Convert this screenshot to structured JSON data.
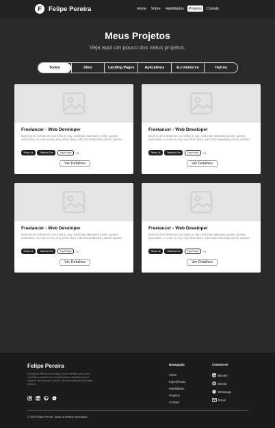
{
  "navbar": {
    "logo_letter": "F",
    "brand": "Felipe Pereira",
    "links": [
      "Home",
      "Sobre",
      "Habilidades",
      "Projetos",
      "Contato"
    ],
    "active_link": "Projetos"
  },
  "hero": {
    "title": "Meus Projetos",
    "subtitle": "Veja aqui um pouco dos meus projetos."
  },
  "filters": {
    "items": [
      "Todos",
      "Sites",
      "Landing Pages",
      "Aplicativos",
      "E-commerce",
      "Outros"
    ],
    "active": "Todos"
  },
  "projects": [
    {
      "title": "Freelancer - Web Developer",
      "description": "Body text for whatever you'd like to say. Add main takeaway points, quotes, anecdotes, or even a very very short story. Add main takeaway points, quotes.",
      "tags": [
        "React.Js",
        "Tailwind.Css",
        "TypeScript"
      ],
      "more": "+3",
      "button": "Ver Detalhes"
    },
    {
      "title": "Freelancer - Web Developer",
      "description": "Body text for whatever you'd like to say. Add main takeaway points, quotes, anecdotes, or even a very very short story. Add main takeaway points, quotes.",
      "tags": [
        "React.Js",
        "Tailwind.Css",
        "TypeScript"
      ],
      "more": "+3",
      "button": "Ver Detalhes"
    },
    {
      "title": "Freelancer - Web Developer",
      "description": "Body text for whatever you'd like to say. Add main takeaway points, quotes, anecdotes, or even a very very short story. Add main takeaway points, quotes.",
      "tags": [
        "React.Js",
        "Tailwind.Css",
        "TypeScript"
      ],
      "more": "+3",
      "button": "Ver Detalhes"
    },
    {
      "title": "Freelancer - Web Developer",
      "description": "Body text for whatever you'd like to say. Add main takeaway points, quotes, anecdotes, or even a very very short story. Add main takeaway points, quotes.",
      "tags": [
        "React.Js",
        "Tailwind.Css",
        "TypeScript"
      ],
      "more": "+3",
      "button": "Ver Detalhes"
    }
  ],
  "footer": {
    "name": "Felipe Pereira",
    "description": "Excepteur efficient emerging, minim veniam anim aute carefully curated Ginza conversation exquisite perfect nostrud nisi intricate Content. Qui international first-class nulla ut.",
    "social_icons": [
      "instagram-icon",
      "linkedin-icon",
      "github-icon",
      "whatsapp-icon"
    ],
    "nav_title": "Navegação",
    "nav_links": [
      "Sobre",
      "Experiências",
      "Habilidades",
      "Projetos",
      "Contato"
    ],
    "connect_title": "Conecte-se",
    "connect_links": [
      {
        "icon": "linkedin-icon",
        "label": "linkedin"
      },
      {
        "icon": "github-icon",
        "label": "GitHub"
      },
      {
        "icon": "whatsapp-icon",
        "label": "Whatsapp"
      },
      {
        "icon": "mail-icon",
        "label": "Email"
      }
    ],
    "copyright": "© 2025 Felipe Pereira. Todos os direitos reservados."
  },
  "colors": {
    "page_bg": "#2a2a2a",
    "nav_bg": "#222222",
    "footer_bg": "#1c1c1c",
    "card_bg": "#ffffff",
    "accent": "#ffffff"
  }
}
